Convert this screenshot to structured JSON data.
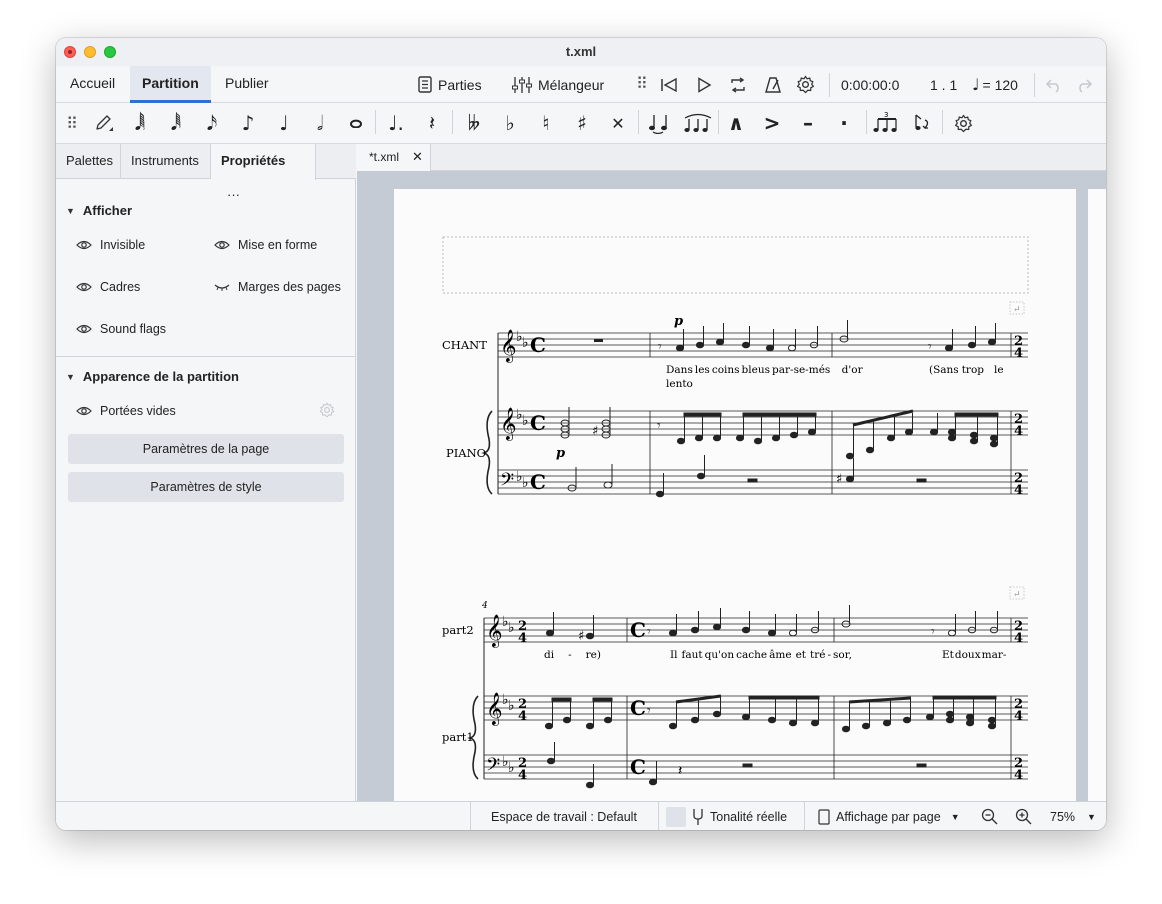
{
  "window": {
    "title": "t.xml"
  },
  "menubar": {
    "tabs": [
      "Accueil",
      "Partition",
      "Publier"
    ],
    "parts_label": "Parties",
    "mixer_label": "Mélangeur",
    "time": "0:00:00:0",
    "position": "1 . 1",
    "tempo": "= 120"
  },
  "panel": {
    "tabs": [
      "Palettes",
      "Instruments",
      "Propriétés"
    ],
    "more": "···",
    "show_section": "Afficher",
    "show_items": [
      "Invisible",
      "Mise en forme",
      "Cadres",
      "Marges des pages",
      "Sound flags"
    ],
    "appearance_section": "Apparence de la partition",
    "empty_staves": "Portées vides",
    "page_settings": "Paramètres de la page",
    "style_settings": "Paramètres de style"
  },
  "document": {
    "tab": "*t.xml"
  },
  "score": {
    "system1": {
      "vocal_label": "CHANT",
      "piano_label": "PIANO",
      "dynamic": "p",
      "lyrics1": [
        "Dans",
        "les",
        "coins",
        "bleus",
        "par",
        "-",
        "se",
        "-",
        "més",
        "d'or",
        "(Sans",
        "trop",
        "le"
      ],
      "lyrics2": [
        "lento"
      ]
    },
    "system2": {
      "measure_number": "4",
      "vocal_label": "part2",
      "piano_label": "part1",
      "lyrics": [
        "di",
        "-",
        "re)",
        "Il",
        "faut",
        "qu'on",
        "cache",
        "âme",
        "et",
        "tré",
        "-",
        "sor,",
        "Et",
        "doux",
        "mar",
        "-"
      ]
    }
  },
  "statusbar": {
    "workspace": "Espace de travail : Default",
    "concert_pitch": "Tonalité réelle",
    "view_mode": "Affichage par page",
    "zoom": "75%"
  }
}
